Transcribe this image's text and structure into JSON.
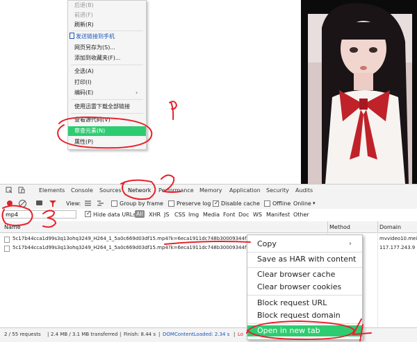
{
  "context_menu_top": {
    "items": [
      {
        "label": "后退(B)",
        "disabled": true
      },
      {
        "label": "前进(F)",
        "disabled": true
      },
      {
        "label": "刷新(R)",
        "disabled": false
      },
      {
        "label": "发送链接到手机",
        "disabled": false
      },
      {
        "label": "网页另存为(S)...",
        "disabled": false
      },
      {
        "label": "添加到收藏夹(F)...",
        "disabled": false
      },
      {
        "label": "全选(A)",
        "disabled": false
      },
      {
        "label": "打印(I)",
        "disabled": false
      },
      {
        "label": "编码(E)",
        "disabled": false
      },
      {
        "label": "使用迅雷下载全部链接",
        "disabled": false
      },
      {
        "label": "查看源代码(V)",
        "disabled": false
      },
      {
        "label": "审查元素(N)",
        "disabled": false
      },
      {
        "label": "属性(P)",
        "disabled": false
      }
    ],
    "highlighted": "审查元素(N)"
  },
  "devtools": {
    "tabs": [
      "Elements",
      "Console",
      "Sources",
      "Network",
      "Performance",
      "Memory",
      "Application",
      "Security",
      "Audits"
    ],
    "active_tab": "Network",
    "toolbar": {
      "view_label": "View:",
      "group_by_frame": "Group by frame",
      "preserve_log": "Preserve log",
      "disable_cache": "Disable cache",
      "offline": "Offline",
      "throttle": "Online"
    },
    "filter": {
      "value": "mp4",
      "hide_data_urls": "Hide data URLs",
      "types": [
        "All",
        "XHR",
        "JS",
        "CSS",
        "Img",
        "Media",
        "Font",
        "Doc",
        "WS",
        "Manifest",
        "Other"
      ]
    },
    "columns": {
      "name": "Name",
      "method": "Method",
      "domain": "Domain"
    },
    "rows": [
      {
        "name": "5c17b44cca1d99s3q13ohq3249_H264_1_5a0c669d03df15.mp4?k=6eca1911dc748b30009344f",
        "domain": "mvvideo10.mei"
      },
      {
        "name": "5c17b44cca1d99s3q13ohq3249_H264_1_5a0c669d03df15.mp4?k=6eca1911dc748b30009344f",
        "domain": "117.177.243.9"
      }
    ],
    "status": {
      "requests": "2 / 55 requests",
      "transferred": "2.4 MB / 3.1 MB transferred",
      "finish": "Finish: 8.44 s",
      "dom": "DOMContentLoaded: 2.34 s",
      "load": "Lo"
    }
  },
  "context_menu_network": {
    "items": [
      "Copy",
      "Save as HAR with content",
      "Clear browser cache",
      "Clear browser cookies",
      "Block request URL",
      "Block request domain",
      "Open in new tab"
    ],
    "highlighted": "Open in new tab"
  },
  "annotations": [
    "1",
    "2",
    "3",
    "4"
  ],
  "colors": {
    "highlight": "#2ecc71",
    "annotation": "#e8202a",
    "link_blue": "#1a56b8"
  }
}
